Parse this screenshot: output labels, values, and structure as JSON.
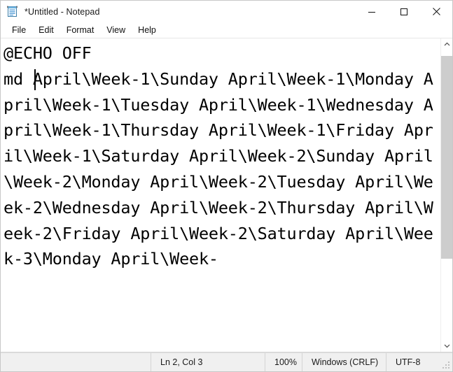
{
  "window": {
    "title": "*Untitled - Notepad",
    "icon": "notepad-icon",
    "controls": {
      "minimize": "minimize-icon",
      "maximize": "maximize-icon",
      "close": "close-icon"
    }
  },
  "menubar": {
    "items": [
      {
        "label": "File"
      },
      {
        "label": "Edit"
      },
      {
        "label": "Format"
      },
      {
        "label": "View"
      },
      {
        "label": "Help"
      }
    ]
  },
  "editor": {
    "content": "@ECHO OFF\nmd April\\Week-1\\Sunday April\\Week-1\\Monday April\\Week-1\\Tuesday April\\Week-1\\Wednesday April\\Week-1\\Thursday April\\Week-1\\Friday April\\Week-1\\Saturday April\\Week-2\\Sunday April\\Week-2\\Monday April\\Week-2\\Tuesday April\\Week-2\\Wednesday April\\Week-2\\Thursday April\\Week-2\\Friday April\\Week-2\\Saturday April\\Week-3\\Monday April\\Week-",
    "caret_after": "md",
    "wrapped_lines": [
      "@ECHO OFF",
      "md April\\Week-1\\Sunday April",
      "\\Week-1\\Monday April\\Week-",
      "1\\Tuesday April\\Week-1\\Wednesday",
      "April\\Week-1\\Thursday April\\Week-",
      "1\\Friday April\\Week-1\\Saturday",
      "April\\Week-2\\Sunday April\\Week-",
      "2\\Monday April\\Week-2\\Tuesday",
      "April\\Week-2\\Wednesday April",
      "\\Week-2\\Thursday April\\Week-",
      "2\\Friday April\\Week-2\\Saturday",
      "April\\Week-3\\Monday April\\Week-"
    ]
  },
  "scrollbar": {
    "up_arrow": "chevron-up-icon",
    "down_arrow": "chevron-down-icon",
    "thumb_top_percent": 2,
    "thumb_height_percent": 70
  },
  "statusbar": {
    "line_col": "Ln 2, Col 3",
    "zoom": "100%",
    "line_ending": "Windows (CRLF)",
    "encoding": "UTF-8"
  },
  "colors": {
    "titlebar_bg": "#ffffff",
    "statusbar_bg": "#f0f0f0",
    "text": "#000000",
    "scroll_thumb": "#cdcdcd",
    "icon_blue": "#4f9ad6"
  }
}
